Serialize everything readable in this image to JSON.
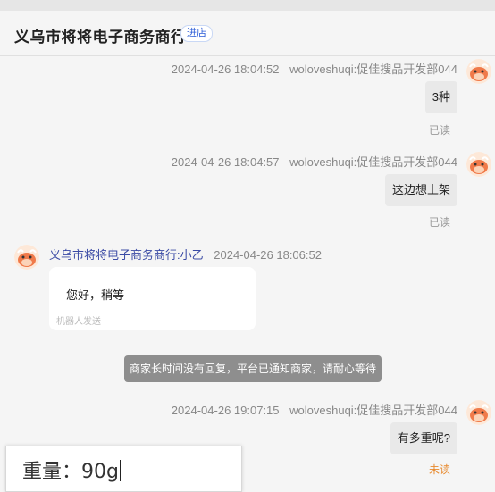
{
  "header": {
    "shop_name": "义乌市将将电子商务商行",
    "enter_label": "进店"
  },
  "messages": [
    {
      "time": "2024-04-26 18:04:52",
      "sender": "woloveshuqi:促佳搜品开发部044",
      "text": "3种",
      "status": "已读"
    },
    {
      "time": "2024-04-26 18:04:57",
      "sender": "woloveshuqi:促佳搜品开发部044",
      "text": "这边想上架",
      "status": "已读"
    },
    {
      "sender": "义乌市将将电子商务商行:小乙",
      "time": "2024-04-26 18:06:52",
      "text": "您好，稍等",
      "note": "机器人发送"
    },
    {
      "time": "2024-04-26 19:07:15",
      "sender": "woloveshuqi:促佳搜品开发部044",
      "text": "有多重呢?",
      "status": "未读"
    }
  ],
  "system_notice": "商家长时间没有回复，平台已通知商家，请耐心等待",
  "input": {
    "value": "重量：90g"
  },
  "colors": {
    "accent": "#3a4aa5",
    "unread": "#e88a2e",
    "notice_bg": "#8e8e8e"
  }
}
